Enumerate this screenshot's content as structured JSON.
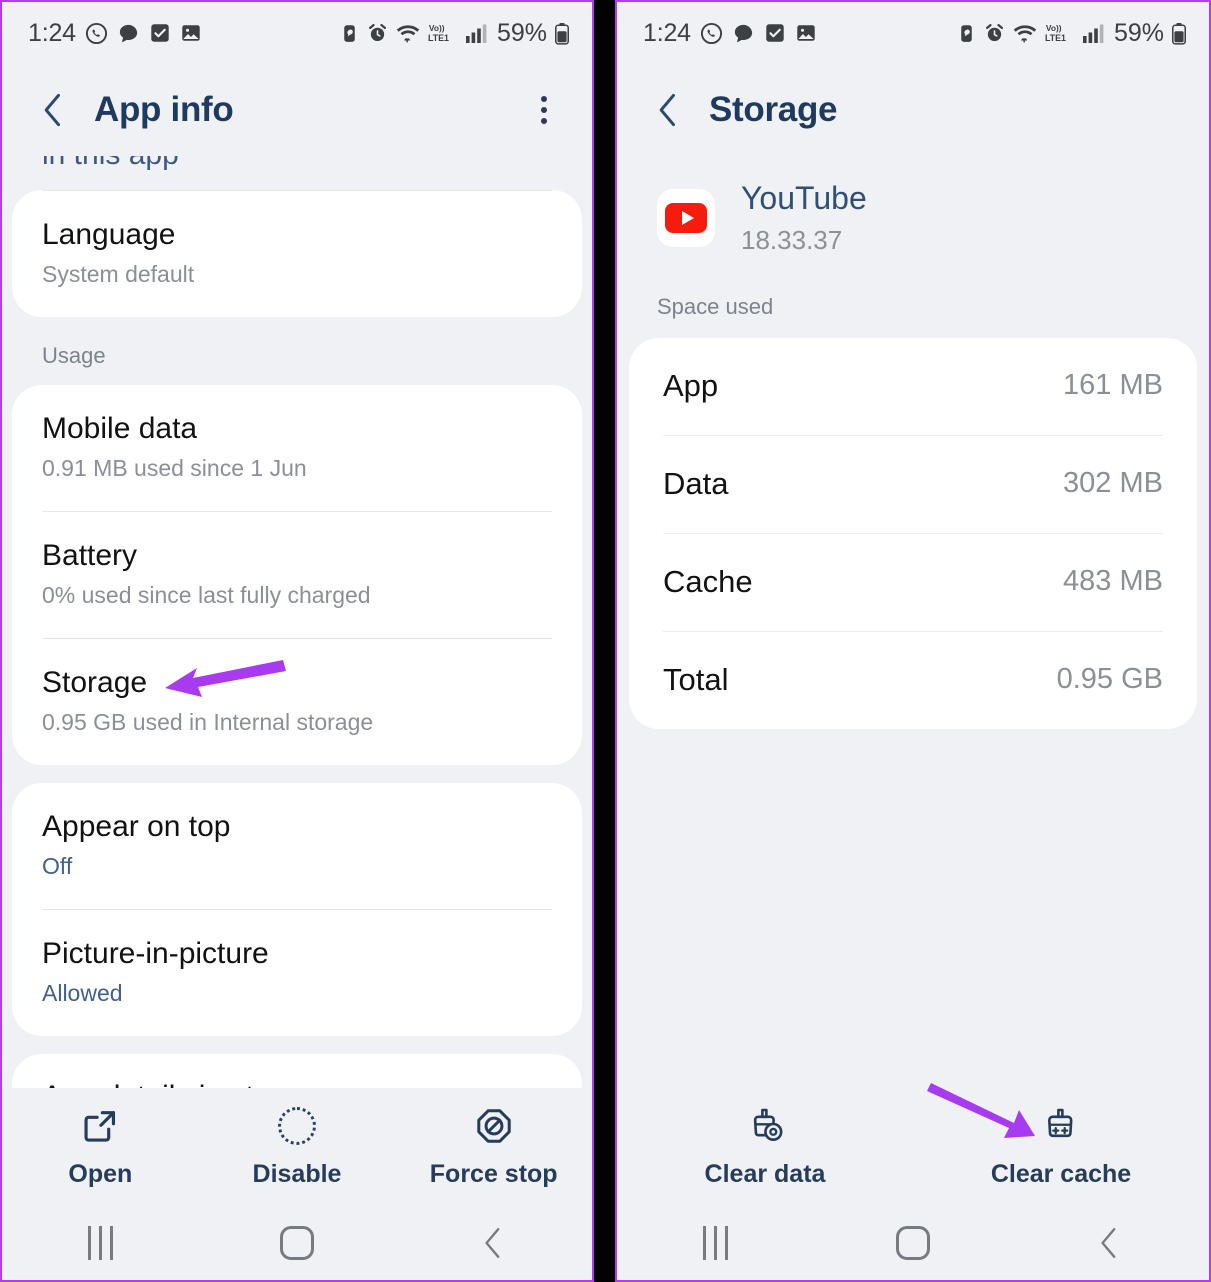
{
  "status_bar": {
    "time": "1:24",
    "left_icons": [
      "whatsapp-icon",
      "chat-bubble-icon",
      "checkbox-icon",
      "image-icon"
    ],
    "right_icons": [
      "data-saver-icon",
      "alarm-icon",
      "wifi-icon",
      "volte-lte1-icon",
      "signal-bars-icon"
    ],
    "battery_percent": "59%",
    "network_label": "Vo))",
    "network_sub": "LTE1"
  },
  "left_panel": {
    "app_bar": {
      "title": "App info",
      "back_icon": "chevron-left-icon",
      "menu_icon": "kebab-menu-icon"
    },
    "clipped_top_text": "in this app",
    "language": {
      "title": "Language",
      "subtitle": "System default"
    },
    "usage_section_label": "Usage",
    "usage_rows": [
      {
        "title": "Mobile data",
        "subtitle": "0.91 MB used since 1 Jun",
        "link": false
      },
      {
        "title": "Battery",
        "subtitle": "0% used since last fully charged",
        "link": false
      },
      {
        "title": "Storage",
        "subtitle": "0.95 GB used in Internal storage",
        "link": false
      }
    ],
    "display_rows": [
      {
        "title": "Appear on top",
        "subtitle": "Off",
        "link": true
      },
      {
        "title": "Picture-in-picture",
        "subtitle": "Allowed",
        "link": true
      }
    ],
    "clipped_bottom_text": "App details in store",
    "actions": [
      {
        "label": "Open",
        "icon": "external-link-icon"
      },
      {
        "label": "Disable",
        "icon": "dotted-circle-icon"
      },
      {
        "label": "Force stop",
        "icon": "octagon-slash-icon"
      }
    ]
  },
  "right_panel": {
    "app_bar": {
      "title": "Storage",
      "back_icon": "chevron-left-icon"
    },
    "app": {
      "name": "YouTube",
      "version": "18.33.37",
      "icon": "youtube-icon"
    },
    "space_used_label": "Space used",
    "space_rows": [
      {
        "label": "App",
        "value": "161 MB"
      },
      {
        "label": "Data",
        "value": "302 MB"
      },
      {
        "label": "Cache",
        "value": "483 MB"
      },
      {
        "label": "Total",
        "value": "0.95 GB"
      }
    ],
    "actions": [
      {
        "label": "Clear data",
        "icon": "broom-data-icon"
      },
      {
        "label": "Clear cache",
        "icon": "broom-sparkle-icon"
      }
    ]
  },
  "nav_bar": {
    "buttons": [
      "recents-icon",
      "home-icon",
      "back-icon"
    ]
  },
  "annotations": {
    "arrow_color": "#a83bf0",
    "arrows": [
      {
        "name": "arrow-to-storage",
        "points": "from (282,664) to (164,686)"
      },
      {
        "name": "arrow-to-clear-cache",
        "points": "from (933,1087) to (1032,1134)"
      }
    ]
  }
}
